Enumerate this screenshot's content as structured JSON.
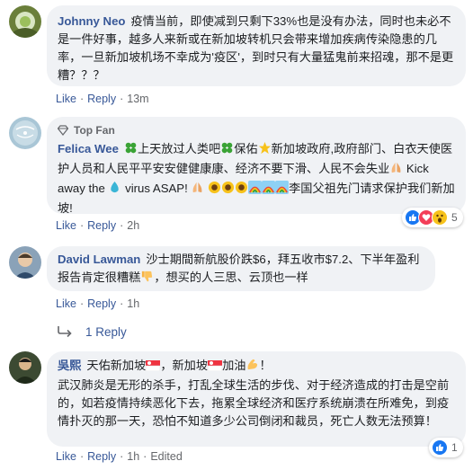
{
  "comments": [
    {
      "author": "Johnny Neo",
      "text": "疫情当前，即使减到只剩下33%也是没有办法，同时也未必不是一件好事，越多人来新或在新加坡转机只会带来增加疾病传染隐患的几率，一旦新加坡机场不幸成为'疫区'，到时只有大量猛鬼前来招魂，那不是更糟？？？",
      "like": "Like",
      "reply": "Reply",
      "time": "13m"
    },
    {
      "badge": "Top Fan",
      "author": "Felica Wee",
      "segments": [
        "上天放过人类吧",
        "保佑",
        "新加坡政府,政府部门、白衣天使医护人员和人民平平安安健健康康、经济不要下滑、人民不会失业",
        "Kick away the ",
        "virus ASAP!",
        "李国父祖先门请求保护我们新加坡!"
      ],
      "like": "Like",
      "reply": "Reply",
      "time": "2h",
      "reaction_count": "5"
    },
    {
      "author": "David Lawman",
      "segments": [
        "沙士期間新航股价跌$6，拜五收市$7.2、下半年盈利报告肯定很糟糕",
        "，想买的人三思、云顶也一样"
      ],
      "like": "Like",
      "reply": "Reply",
      "time": "1h",
      "replies_label": "1 Reply"
    },
    {
      "author": "吳熙",
      "segments": [
        "天佑新加坡",
        "，新加坡",
        "加油",
        "！",
        "武汉肺炎是无形的杀手，打乱全球生活的步伐、对于经济造成的打击是空前的，如若疫情持续恶化下去，拖累全球经济和医疗系统崩溃在所难免，到疫情扑灭的那一天，恐怕不知道多少公司倒闭和裁员，死亡人数无法预算！"
      ],
      "like": "Like",
      "reply": "Reply",
      "time": "1h",
      "edited": "Edited",
      "reaction_count": "1"
    }
  ],
  "colors": {
    "link": "#385898",
    "meta": "#65676b",
    "bubble": "#f0f2f5",
    "like_blue": "#1877f2",
    "love_red": "#f33e58"
  },
  "icons": {
    "reply_arrow": "reply-arrow-icon",
    "top_fan": "diamond-icon",
    "clover": "clover-icon",
    "star": "star-icon",
    "droplet": "microbe-icon",
    "pray": "pray-icon",
    "sunflower": "sunflower-icon",
    "rainbow": "rainbow-icon",
    "thumbs_down": "thumbs-down-icon",
    "flag": "singapore-flag-icon",
    "flex": "flexed-biceps-icon"
  }
}
